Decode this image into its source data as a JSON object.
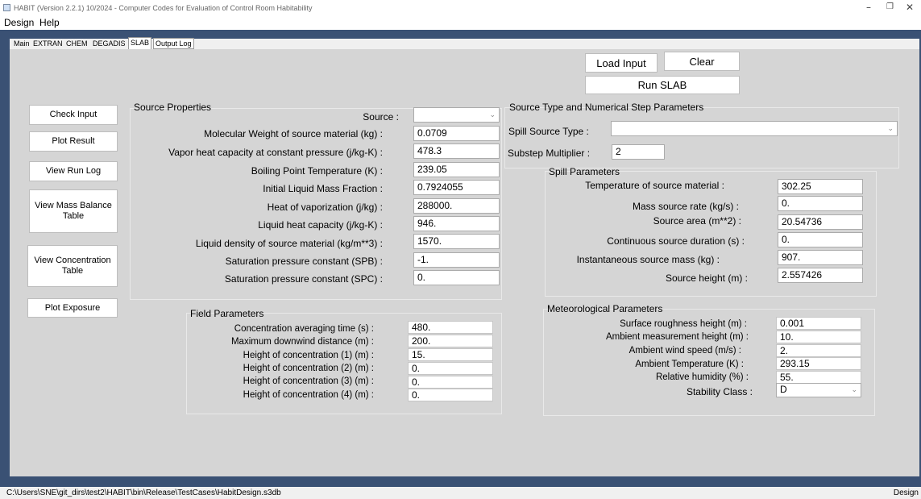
{
  "window": {
    "title": "HABIT (Version 2.2.1) 10/2024 - Computer Codes for Evaluation of Control Room Habitability",
    "minimize_glyph": "–",
    "restore_glyph": "❐",
    "close_glyph": "✕"
  },
  "menu": [
    "Design",
    "Help"
  ],
  "tabs": [
    "Main",
    "EXTRAN",
    "CHEM",
    "DEGADIS",
    "SLAB",
    "Output Log"
  ],
  "active_tab": "SLAB",
  "buttons": {
    "load_input": "Load Input",
    "clear": "Clear",
    "run_slab": "Run SLAB",
    "check_input": "Check Input",
    "plot_result": "Plot Result",
    "view_run_log": "View Run Log",
    "view_mass_balance": "View Mass Balance Table",
    "view_concentration": "View Concentration Table",
    "plot_exposure": "Plot Exposure"
  },
  "source_properties": {
    "title": "Source Properties",
    "source_label": "Source :",
    "source_value": "",
    "fields": [
      {
        "label": "Molecular Weight of source material (kg) :",
        "value": "0.0709"
      },
      {
        "label": "Vapor heat capacity at constant pressure (j/kg-K) :",
        "value": "478.3"
      },
      {
        "label": "Boiling Point Temperature (K) :",
        "value": "239.05"
      },
      {
        "label": "Initial Liquid Mass Fraction :",
        "value": "0.7924055"
      },
      {
        "label": "Heat of vaporization (j/kg) :",
        "value": "288000."
      },
      {
        "label": "Liquid heat capacity (j/kg-K) :",
        "value": "946."
      },
      {
        "label": "Liquid density of source material (kg/m**3) :",
        "value": "1570."
      },
      {
        "label": "Saturation pressure constant (SPB) :",
        "value": "-1."
      },
      {
        "label": "Saturation pressure constant (SPC) :",
        "value": "0."
      }
    ]
  },
  "source_type": {
    "title": "Source Type and Numerical Step Parameters",
    "spill_type_label": "Spill Source Type :",
    "spill_type_value": "",
    "substep_label": "Substep Multiplier :",
    "substep_value": "2"
  },
  "spill_parameters": {
    "title": "Spill Parameters",
    "fields": [
      {
        "label": "Temperature of source material :",
        "value": "302.25"
      },
      {
        "label": "Mass source rate (kg/s) :",
        "value": "0."
      },
      {
        "label": "Source area (m**2) :",
        "value": "20.54736"
      },
      {
        "label": "Continuous source duration (s) :",
        "value": "0."
      },
      {
        "label": "Instantaneous source mass (kg) :",
        "value": "907."
      },
      {
        "label": "Source height (m) :",
        "value": "2.557426"
      }
    ]
  },
  "field_parameters": {
    "title": "Field Parameters",
    "fields": [
      {
        "label": "Concentration averaging time (s) :",
        "value": "480."
      },
      {
        "label": "Maximum downwind distance (m) :",
        "value": "200."
      },
      {
        "label": "Height of concentration (1) (m) :",
        "value": "15."
      },
      {
        "label": "Height of concentration (2) (m) :",
        "value": "0."
      },
      {
        "label": "Height of concentration (3) (m) :",
        "value": "0."
      },
      {
        "label": "Height of concentration (4) (m) :",
        "value": "0."
      }
    ]
  },
  "meteorological": {
    "title": "Meteorological Parameters",
    "fields": [
      {
        "label": "Surface roughness height (m) :",
        "value": "0.001"
      },
      {
        "label": "Ambient measurement height (m) :",
        "value": "10."
      },
      {
        "label": "Ambient wind speed (m/s) :",
        "value": "2."
      },
      {
        "label": "Ambient Temperature (K) :",
        "value": "293.15"
      },
      {
        "label": "Relative humidity (%) :",
        "value": "55."
      }
    ],
    "stability_label": "Stability Class :",
    "stability_value": "D"
  },
  "statusbar": {
    "path": "C:\\Users\\SNE\\git_dirs\\test2\\HABIT\\bin\\Release\\TestCases\\HabitDesign.s3db",
    "mode": "Design"
  },
  "colors": {
    "frame": "#3a5174",
    "panel": "#d5d5d5"
  },
  "icons": {
    "dropdown": "chevron-down-icon",
    "app": "habit-app-icon"
  }
}
